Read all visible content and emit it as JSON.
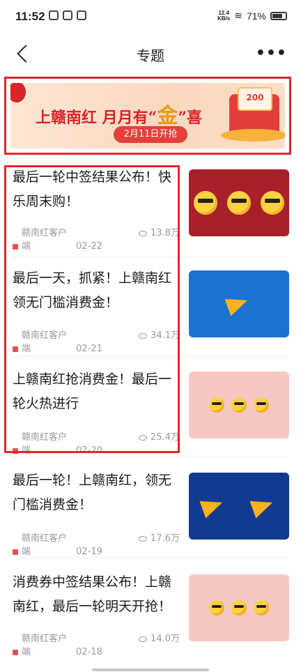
{
  "status_bar": {
    "time": "11:52",
    "network_speed_top": "12.4",
    "network_speed_unit": "KB/s",
    "battery": "71%"
  },
  "header": {
    "title": "专题"
  },
  "banner": {
    "slogan_prefix": "上赣南红 月月有“",
    "slogan_highlight": "金",
    "slogan_suffix": "”喜",
    "button_label": "2月11日开抢",
    "coupon_amount": "200"
  },
  "articles": [
    {
      "title": "最后一轮中签结果公布！快乐周末购！",
      "source": "赣南红客户端",
      "date": "02-22",
      "views": "13.8万",
      "thumb": "faces-red"
    },
    {
      "title": "最后一天，抓紧！上赣南红领无门槛消费金！",
      "source": "赣南红客户端",
      "date": "02-21",
      "views": "34.1万",
      "thumb": "horn-blue"
    },
    {
      "title": "上赣南红抢消费金！最后一轮火热进行",
      "source": "赣南红客户端",
      "date": "02-20",
      "views": "25.4万",
      "thumb": "faces-pink"
    },
    {
      "title": "最后一轮！上赣南红，领无门槛消费金！",
      "source": "赣南红客户端",
      "date": "02-19",
      "views": "17.6万",
      "thumb": "horns-navy"
    },
    {
      "title": "消费券中签结果公布！上赣南红，最后一轮明天开抢！",
      "source": "赣南红客户端",
      "date": "02-18",
      "views": "14.0万",
      "thumb": "faces-pink"
    }
  ],
  "colors": {
    "accent_red": "#e0262f",
    "thumb_red": "#a7202a",
    "thumb_blue": "#1a73d1",
    "thumb_pink": "#f7c8c3",
    "thumb_navy": "#123a8f"
  }
}
